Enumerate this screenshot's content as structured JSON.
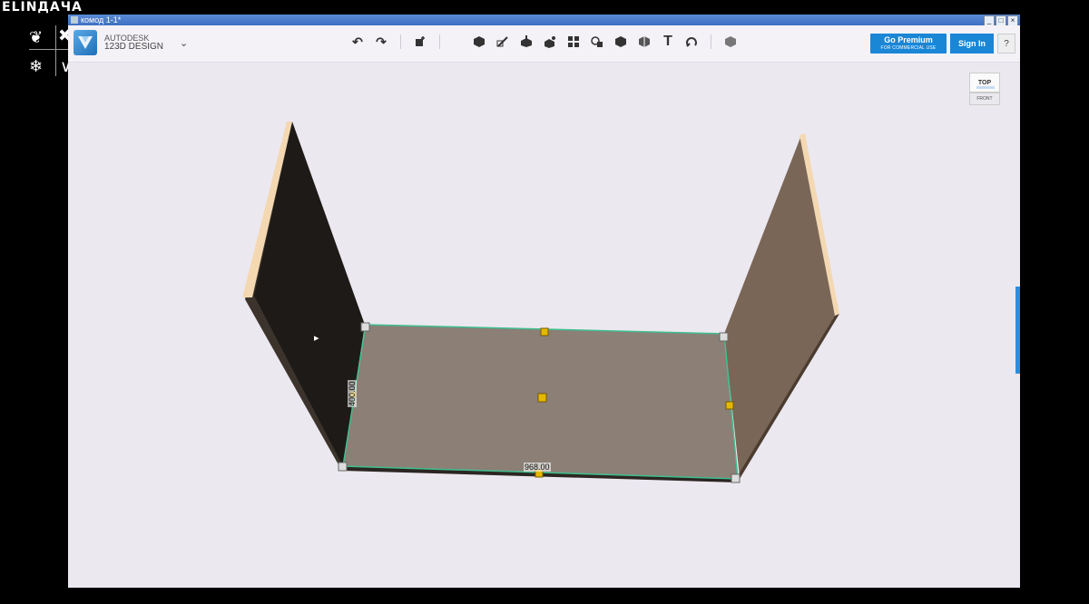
{
  "channel_logo": "ELINДАЧА",
  "window": {
    "title": "комод 1-1*",
    "controls": [
      "_",
      "□",
      "×"
    ]
  },
  "brand": {
    "line1": "AUTODESK",
    "line2": "123D DESIGN",
    "menu_chevron": "⌄"
  },
  "toolbar": {
    "undo_icon": "↶",
    "redo_icon": "↷",
    "tools": [
      "primitives-icon",
      "sketch-icon",
      "construct-icon",
      "modify-icon",
      "pattern-icon",
      "grouping-icon",
      "combine-icon",
      "measure-icon",
      "text-icon",
      "snap-icon",
      "material-icon"
    ],
    "text_tool_glyph": "T"
  },
  "premium": {
    "label": "Go Premium",
    "sublabel": "FOR COMMERCIAL USE"
  },
  "signin": {
    "label": "Sign In"
  },
  "help": {
    "label": "?"
  },
  "viewcube": {
    "top": "TOP",
    "front": "FRONT"
  },
  "dimensions": {
    "height": "400.00",
    "width": "968.00"
  },
  "colors": {
    "accent": "#1a86d6",
    "viewport_bg": "#ece8f0",
    "panel_face": "#8b7f76",
    "left_wall": "#1e1a17",
    "right_wall": "#7a6657",
    "edge_highlight": "#f3d8b2",
    "selection_outline": "#3fbf8f",
    "handle": "#e5b800"
  }
}
